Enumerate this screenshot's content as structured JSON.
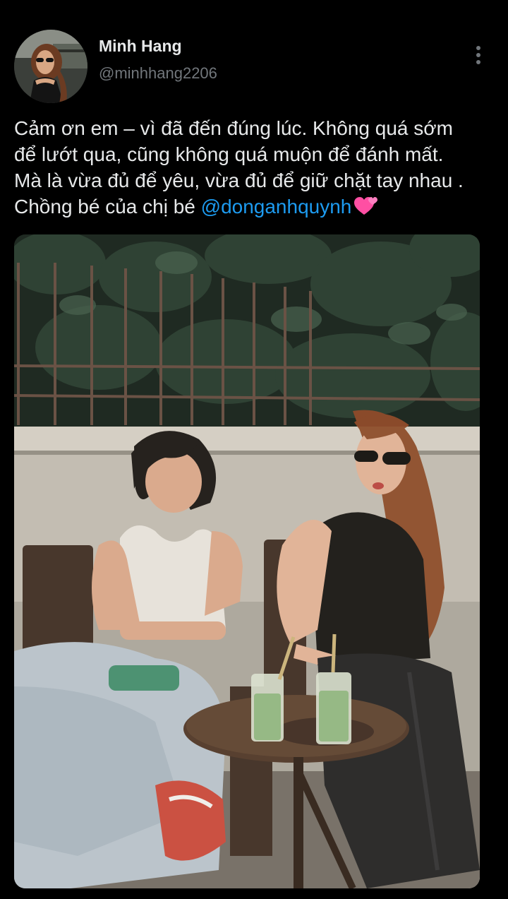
{
  "author": {
    "display_name": "Minh Hang",
    "handle": "@minhhang2206"
  },
  "icons": {
    "avatar": "profile-photo",
    "more": "vertical-ellipsis-icon",
    "emoji": "two-hearts-emoji"
  },
  "tweet": {
    "lines": [
      "Cảm ơn em – vì đã đến đúng lúc. Không quá sớm",
      "để lướt qua, cũng không quá muộn để đánh mất.",
      "Mà là vừa đủ để yêu, vừa đủ để giữ chặt tay nhau .",
      "Chồng bé của chị bé "
    ],
    "mention": "@donganhquynh"
  },
  "colors": {
    "background": "#000000",
    "text": "#e7e9ea",
    "secondary_text": "#71767b",
    "link": "#1d9bf0",
    "emoji_pink": "#ff4fa3"
  }
}
